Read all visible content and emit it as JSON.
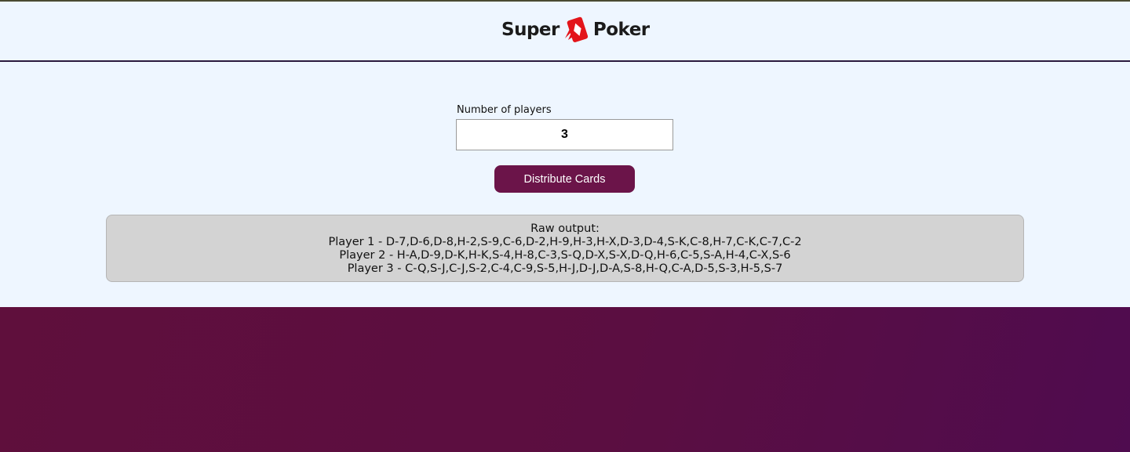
{
  "header": {
    "logo_left": "Super",
    "logo_right": "Poker",
    "logo_icon": "playing-card-icon"
  },
  "form": {
    "players_label": "Number of players",
    "players_value": "3",
    "distribute_label": "Distribute Cards"
  },
  "output": {
    "heading": "Raw output:",
    "lines": [
      "Player 1 - D-7,D-6,D-8,H-2,S-9,C-6,D-2,H-9,H-3,H-X,D-3,D-4,S-K,C-8,H-7,C-K,C-7,C-2",
      "Player 2 - H-A,D-9,D-K,H-K,S-4,H-8,C-3,S-Q,D-X,S-X,D-Q,H-6,C-5,S-A,H-4,C-X,S-6",
      "Player 3 - C-Q,S-J,C-J,S-2,C-4,C-9,S-5,H-J,D-J,D-A,S-8,H-Q,C-A,D-5,S-3,H-5,S-7"
    ]
  },
  "colors": {
    "brand": "#6b1449",
    "card_red": "#e3151a",
    "background": "#eef6ff",
    "output_bg": "#d3d3d3"
  }
}
